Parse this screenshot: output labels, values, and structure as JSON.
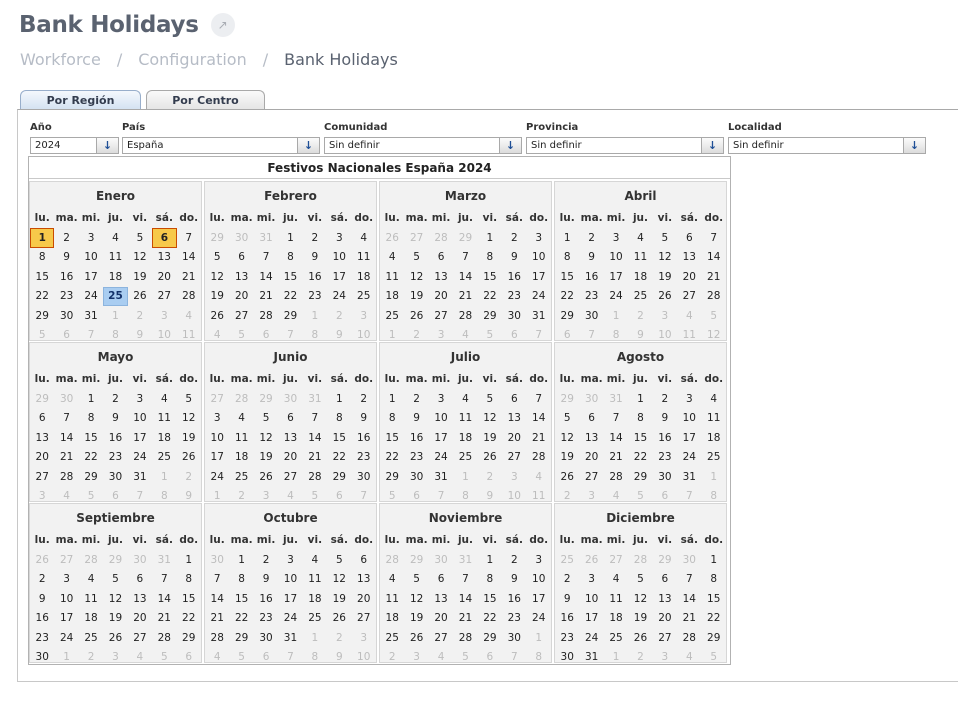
{
  "page": {
    "title": "Bank Holidays",
    "expand_icon": "↗",
    "breadcrumb": [
      "Workforce",
      "Configuration",
      "Bank Holidays"
    ],
    "breadcrumb_sep": "/"
  },
  "tabs": [
    {
      "label": "Por Región",
      "active": true
    },
    {
      "label": "Por Centro",
      "active": false
    }
  ],
  "filters": {
    "year": {
      "label": "Año",
      "value": "2024"
    },
    "country": {
      "label": "País",
      "value": "España"
    },
    "community": {
      "label": "Comunidad",
      "value": "Sin definir"
    },
    "province": {
      "label": "Provincia",
      "value": "Sin definir"
    },
    "locality": {
      "label": "Localidad",
      "value": "Sin definir"
    },
    "arrow_icon": "↓"
  },
  "calendar": {
    "title": "Festivos Nacionales España 2024",
    "weekdays": [
      "lu.",
      "ma.",
      "mi.",
      "ju.",
      "vi.",
      "sá.",
      "do."
    ],
    "colors": {
      "holiday": "#f7c94a",
      "holiday_border": "#c94b00",
      "today": "#a9cdf1",
      "other_month": "#bdbdbd"
    },
    "months": [
      {
        "name": "Enero",
        "holidays": [
          1,
          6
        ],
        "today": 25,
        "weeks": [
          [
            "1",
            "2",
            "3",
            "4",
            "5",
            "6",
            "7"
          ],
          [
            "8",
            "9",
            "10",
            "11",
            "12",
            "13",
            "14"
          ],
          [
            "15",
            "16",
            "17",
            "18",
            "19",
            "20",
            "21"
          ],
          [
            "22",
            "23",
            "24",
            "25",
            "26",
            "27",
            "28"
          ],
          [
            "29",
            "30",
            "31",
            "1",
            "2",
            "3",
            "4"
          ],
          [
            "5",
            "6",
            "7",
            "8",
            "9",
            "10",
            "11"
          ]
        ]
      },
      {
        "name": "Febrero",
        "holidays": [],
        "weeks": [
          [
            "29",
            "30",
            "31",
            "1",
            "2",
            "3",
            "4"
          ],
          [
            "5",
            "6",
            "7",
            "8",
            "9",
            "10",
            "11"
          ],
          [
            "12",
            "13",
            "14",
            "15",
            "16",
            "17",
            "18"
          ],
          [
            "19",
            "20",
            "21",
            "22",
            "23",
            "24",
            "25"
          ],
          [
            "26",
            "27",
            "28",
            "29",
            "1",
            "2",
            "3"
          ],
          [
            "4",
            "5",
            "6",
            "7",
            "8",
            "9",
            "10"
          ]
        ]
      },
      {
        "name": "Marzo",
        "holidays": [],
        "weeks": [
          [
            "26",
            "27",
            "28",
            "29",
            "1",
            "2",
            "3"
          ],
          [
            "4",
            "5",
            "6",
            "7",
            "8",
            "9",
            "10"
          ],
          [
            "11",
            "12",
            "13",
            "14",
            "15",
            "16",
            "17"
          ],
          [
            "18",
            "19",
            "20",
            "21",
            "22",
            "23",
            "24"
          ],
          [
            "25",
            "26",
            "27",
            "28",
            "29",
            "30",
            "31"
          ],
          [
            "1",
            "2",
            "3",
            "4",
            "5",
            "6",
            "7"
          ]
        ]
      },
      {
        "name": "Abril",
        "holidays": [],
        "weeks": [
          [
            "1",
            "2",
            "3",
            "4",
            "5",
            "6",
            "7"
          ],
          [
            "8",
            "9",
            "10",
            "11",
            "12",
            "13",
            "14"
          ],
          [
            "15",
            "16",
            "17",
            "18",
            "19",
            "20",
            "21"
          ],
          [
            "22",
            "23",
            "24",
            "25",
            "26",
            "27",
            "28"
          ],
          [
            "29",
            "30",
            "1",
            "2",
            "3",
            "4",
            "5"
          ],
          [
            "6",
            "7",
            "8",
            "9",
            "10",
            "11",
            "12"
          ]
        ]
      },
      {
        "name": "Mayo",
        "holidays": [],
        "weeks": [
          [
            "29",
            "30",
            "1",
            "2",
            "3",
            "4",
            "5"
          ],
          [
            "6",
            "7",
            "8",
            "9",
            "10",
            "11",
            "12"
          ],
          [
            "13",
            "14",
            "15",
            "16",
            "17",
            "18",
            "19"
          ],
          [
            "20",
            "21",
            "22",
            "23",
            "24",
            "25",
            "26"
          ],
          [
            "27",
            "28",
            "29",
            "30",
            "31",
            "1",
            "2"
          ],
          [
            "3",
            "4",
            "5",
            "6",
            "7",
            "8",
            "9"
          ]
        ]
      },
      {
        "name": "Junio",
        "holidays": [],
        "weeks": [
          [
            "27",
            "28",
            "29",
            "30",
            "31",
            "1",
            "2"
          ],
          [
            "3",
            "4",
            "5",
            "6",
            "7",
            "8",
            "9"
          ],
          [
            "10",
            "11",
            "12",
            "13",
            "14",
            "15",
            "16"
          ],
          [
            "17",
            "18",
            "19",
            "20",
            "21",
            "22",
            "23"
          ],
          [
            "24",
            "25",
            "26",
            "27",
            "28",
            "29",
            "30"
          ],
          [
            "1",
            "2",
            "3",
            "4",
            "5",
            "6",
            "7"
          ]
        ]
      },
      {
        "name": "Julio",
        "holidays": [],
        "weeks": [
          [
            "1",
            "2",
            "3",
            "4",
            "5",
            "6",
            "7"
          ],
          [
            "8",
            "9",
            "10",
            "11",
            "12",
            "13",
            "14"
          ],
          [
            "15",
            "16",
            "17",
            "18",
            "19",
            "20",
            "21"
          ],
          [
            "22",
            "23",
            "24",
            "25",
            "26",
            "27",
            "28"
          ],
          [
            "29",
            "30",
            "31",
            "1",
            "2",
            "3",
            "4"
          ],
          [
            "5",
            "6",
            "7",
            "8",
            "9",
            "10",
            "11"
          ]
        ]
      },
      {
        "name": "Agosto",
        "holidays": [],
        "weeks": [
          [
            "29",
            "30",
            "31",
            "1",
            "2",
            "3",
            "4"
          ],
          [
            "5",
            "6",
            "7",
            "8",
            "9",
            "10",
            "11"
          ],
          [
            "12",
            "13",
            "14",
            "15",
            "16",
            "17",
            "18"
          ],
          [
            "19",
            "20",
            "21",
            "22",
            "23",
            "24",
            "25"
          ],
          [
            "26",
            "27",
            "28",
            "29",
            "30",
            "31",
            "1"
          ],
          [
            "2",
            "3",
            "4",
            "5",
            "6",
            "7",
            "8"
          ]
        ]
      },
      {
        "name": "Septiembre",
        "holidays": [],
        "weeks": [
          [
            "26",
            "27",
            "28",
            "29",
            "30",
            "31",
            "1"
          ],
          [
            "2",
            "3",
            "4",
            "5",
            "6",
            "7",
            "8"
          ],
          [
            "9",
            "10",
            "11",
            "12",
            "13",
            "14",
            "15"
          ],
          [
            "16",
            "17",
            "18",
            "19",
            "20",
            "21",
            "22"
          ],
          [
            "23",
            "24",
            "25",
            "26",
            "27",
            "28",
            "29"
          ],
          [
            "30",
            "1",
            "2",
            "3",
            "4",
            "5",
            "6"
          ]
        ]
      },
      {
        "name": "Octubre",
        "holidays": [],
        "weeks": [
          [
            "30",
            "1",
            "2",
            "3",
            "4",
            "5",
            "6"
          ],
          [
            "7",
            "8",
            "9",
            "10",
            "11",
            "12",
            "13"
          ],
          [
            "14",
            "15",
            "16",
            "17",
            "18",
            "19",
            "20"
          ],
          [
            "21",
            "22",
            "23",
            "24",
            "25",
            "26",
            "27"
          ],
          [
            "28",
            "29",
            "30",
            "31",
            "1",
            "2",
            "3"
          ],
          [
            "4",
            "5",
            "6",
            "7",
            "8",
            "9",
            "10"
          ]
        ]
      },
      {
        "name": "Noviembre",
        "holidays": [],
        "weeks": [
          [
            "28",
            "29",
            "30",
            "31",
            "1",
            "2",
            "3"
          ],
          [
            "4",
            "5",
            "6",
            "7",
            "8",
            "9",
            "10"
          ],
          [
            "11",
            "12",
            "13",
            "14",
            "15",
            "16",
            "17"
          ],
          [
            "18",
            "19",
            "20",
            "21",
            "22",
            "23",
            "24"
          ],
          [
            "25",
            "26",
            "27",
            "28",
            "29",
            "30",
            "1"
          ],
          [
            "2",
            "3",
            "4",
            "5",
            "6",
            "7",
            "8"
          ]
        ]
      },
      {
        "name": "Diciembre",
        "holidays": [],
        "weeks": [
          [
            "25",
            "26",
            "27",
            "28",
            "29",
            "30",
            "1"
          ],
          [
            "2",
            "3",
            "4",
            "5",
            "6",
            "7",
            "8"
          ],
          [
            "9",
            "10",
            "11",
            "12",
            "13",
            "14",
            "15"
          ],
          [
            "16",
            "17",
            "18",
            "19",
            "20",
            "21",
            "22"
          ],
          [
            "23",
            "24",
            "25",
            "26",
            "27",
            "28",
            "29"
          ],
          [
            "30",
            "31",
            "1",
            "2",
            "3",
            "4",
            "5"
          ]
        ]
      }
    ]
  }
}
